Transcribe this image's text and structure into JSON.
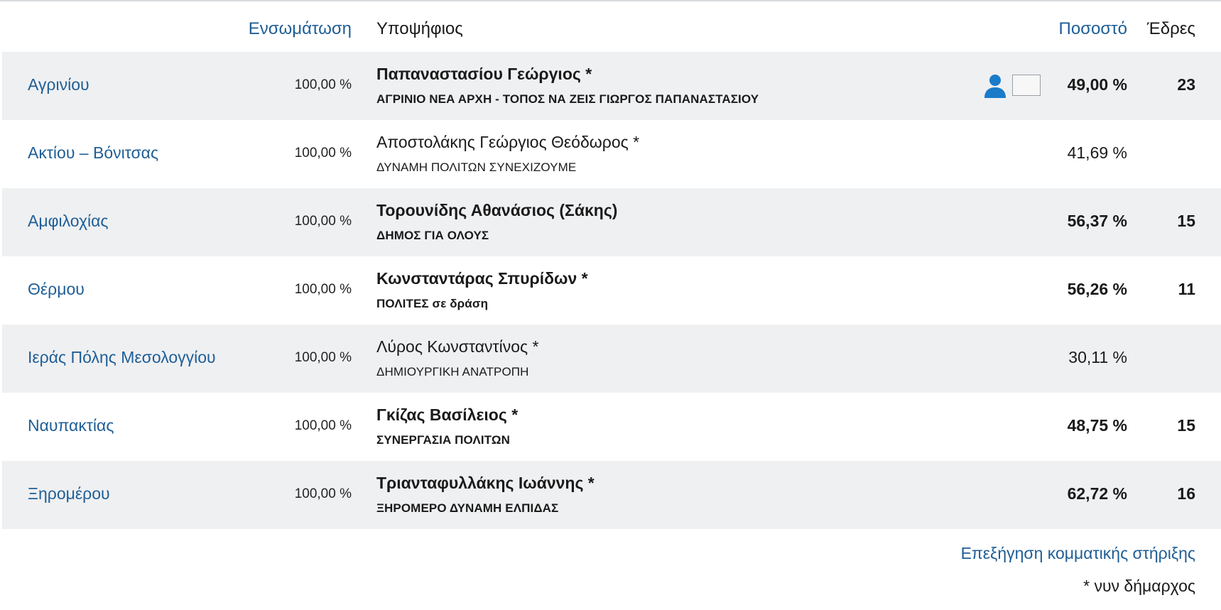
{
  "header": {
    "incorporation": "Ενσωμάτωση",
    "candidate": "Υποψήφιος",
    "percentage": "Ποσοστό",
    "seats": "Έδρες"
  },
  "rows": [
    {
      "municipality": "Αγρινίου",
      "incorporation": "100,00 %",
      "candidate": "Παπαναστασίου Γεώργιος *",
      "party": "ΑΓΡΙΝΙΟ ΝΕΑ ΑΡΧΗ - ΤΟΠΟΣ ΝΑ ΖΕΙΣ ΓΙΩΡΓΟΣ ΠΑΠΑΝΑΣΤΑΣΙΟΥ",
      "percentage": "49,00 %",
      "seats": "23",
      "winner": true
    },
    {
      "municipality": "Ακτίου – Βόνιτσας",
      "incorporation": "100,00 %",
      "candidate": "Αποστολάκης Γεώργιος Θεόδωρος *",
      "party": "ΔΥΝΑΜΗ ΠΟΛΙΤΩΝ ΣΥΝΕΧΙΖΟΥΜΕ",
      "percentage": "41,69 %",
      "seats": "",
      "winner": false
    },
    {
      "municipality": "Αμφιλοχίας",
      "incorporation": "100,00 %",
      "candidate": "Τορουνίδης Αθανάσιος (Σάκης)",
      "party": "ΔΗΜΟΣ ΓΙΑ ΟΛΟΥΣ",
      "percentage": "56,37 %",
      "seats": "15",
      "winner": true
    },
    {
      "municipality": "Θέρμου",
      "incorporation": "100,00 %",
      "candidate": "Κωνσταντάρας Σπυρίδων *",
      "party": "ΠΟΛΙΤΕΣ σε δράση",
      "percentage": "56,26 %",
      "seats": "11",
      "winner": true
    },
    {
      "municipality": "Ιεράς Πόλης Μεσολογγίου",
      "incorporation": "100,00 %",
      "candidate": "Λύρος Κωνσταντίνος *",
      "party": "ΔΗΜΙΟΥΡΓΙΚΗ ΑΝΑΤΡΟΠΗ",
      "percentage": "30,11 %",
      "seats": "",
      "winner": false
    },
    {
      "municipality": "Ναυπακτίας",
      "incorporation": "100,00 %",
      "candidate": "Γκίζας Βασίλειος *",
      "party": "ΣΥΝΕΡΓΑΣΙΑ ΠΟΛΙΤΩΝ",
      "percentage": "48,75 %",
      "seats": "15",
      "winner": true
    },
    {
      "municipality": "Ξηρομέρου",
      "incorporation": "100,00 %",
      "candidate": "Τριανταφυλλάκης Ιωάννης *",
      "party": "ΞΗΡΟΜΕΡΟ ΔΥΝΑΜΗ ΕΛΠΙΔΑΣ",
      "percentage": "62,72 %",
      "seats": "16",
      "winner": true
    }
  ],
  "icons": {
    "person": "person-icon",
    "color": "#1a7bc9"
  },
  "footer": {
    "link": "Επεξήγηση κομματικής στήριξης",
    "note": "* νυν δήμαρχος"
  }
}
